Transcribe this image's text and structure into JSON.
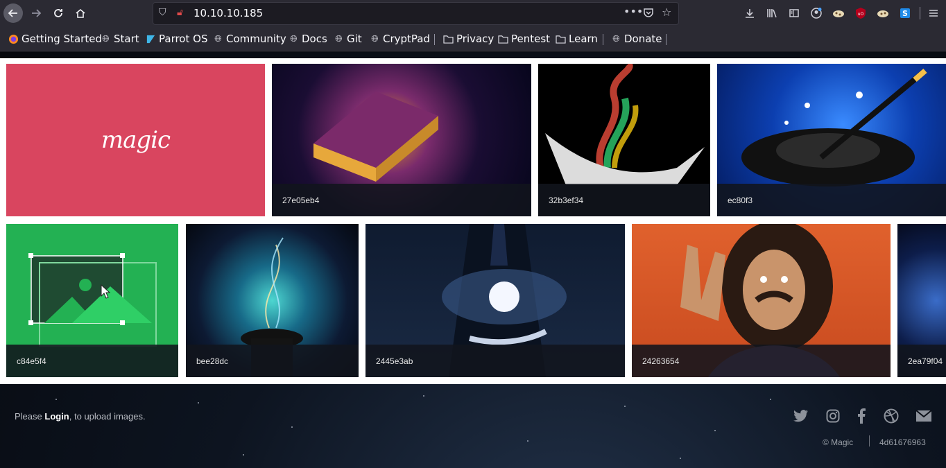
{
  "browser": {
    "url": "10.10.10.185",
    "bookmarks": [
      {
        "label": "Getting Started",
        "icon": "firefox-icon"
      },
      {
        "label": "Start",
        "icon": "globe-icon"
      },
      {
        "label": "Parrot OS",
        "icon": "parrot-icon"
      },
      {
        "label": "Community",
        "icon": "globe-icon"
      },
      {
        "label": "Docs",
        "icon": "globe-icon"
      },
      {
        "label": "Git",
        "icon": "globe-icon"
      },
      {
        "label": "CryptPad",
        "icon": "globe-icon"
      },
      {
        "label": "Privacy",
        "icon": "folder-icon"
      },
      {
        "label": "Pentest",
        "icon": "folder-icon"
      },
      {
        "label": "Learn",
        "icon": "folder-icon"
      },
      {
        "label": "Donate",
        "icon": "globe-icon"
      }
    ]
  },
  "gallery": {
    "logo_text": "magic",
    "items": [
      {
        "caption": "27e05eb4"
      },
      {
        "caption": "32b3ef34"
      },
      {
        "caption": "ec80f3"
      },
      {
        "caption": "c84e5f4"
      },
      {
        "caption": "bee28dc"
      },
      {
        "caption": "2445e3ab"
      },
      {
        "caption": "24263654"
      },
      {
        "caption": "2ea79f04"
      }
    ]
  },
  "footer": {
    "prefix": "Please ",
    "login": "Login",
    "suffix": ", to upload images.",
    "copyright": "© Magic",
    "hash": "4d61676963"
  },
  "colors": {
    "accent_red": "#d9455f",
    "accent_green": "#23b153"
  }
}
